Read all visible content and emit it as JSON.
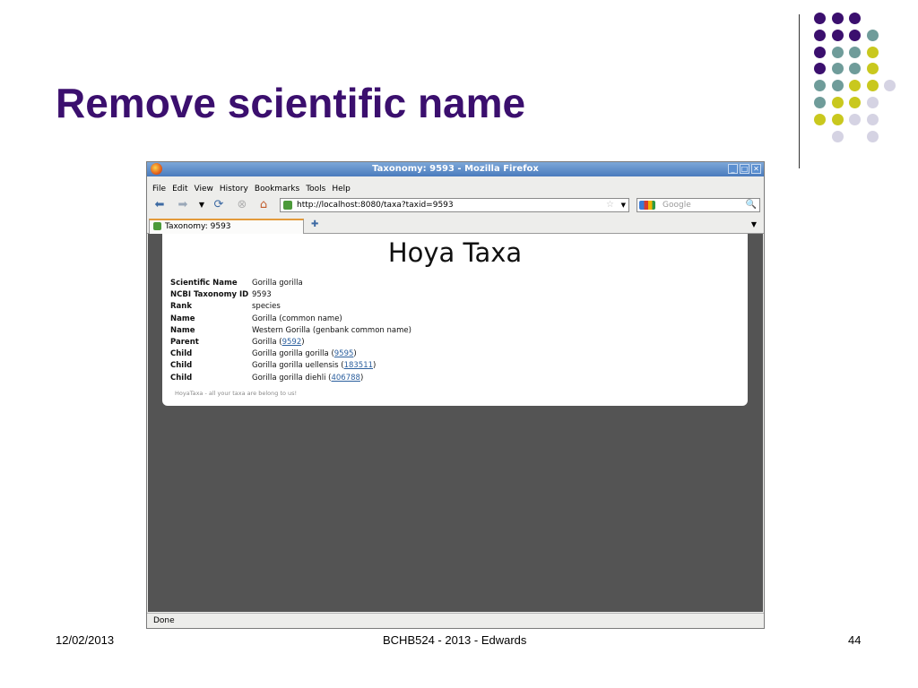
{
  "slide": {
    "title": "Remove scientific name",
    "footer_date": "12/02/2013",
    "footer_center": "BCHB524 - 2013 - Edwards",
    "footer_page": "44",
    "dot_colors": {
      "purple": "#3b0f6e",
      "teal": "#6f9c9a",
      "yellow": "#c9c81e",
      "lavender": "#d5d3e3"
    }
  },
  "browser": {
    "window_title": "Taxonomy: 9593 - Mozilla Firefox",
    "menu": [
      "File",
      "Edit",
      "View",
      "History",
      "Bookmarks",
      "Tools",
      "Help"
    ],
    "url": "http://localhost:8080/taxa?taxid=9593",
    "search_placeholder": "Google",
    "tab_label": "Taxonomy: 9593",
    "status": "Done",
    "icons": {
      "back": "back-arrow-icon",
      "forward": "forward-arrow-icon",
      "dropdown": "chevron-down-icon",
      "reload": "reload-icon",
      "stop": "stop-icon",
      "home": "home-icon",
      "bookmark_star": "star-icon",
      "search": "search-icon",
      "new_tab": "plus-icon"
    }
  },
  "page": {
    "heading": "Hoya Taxa",
    "rows": [
      {
        "key": "Scientific Name",
        "text": "Gorilla gorilla",
        "link": "",
        "suffix": ""
      },
      {
        "key": "NCBI Taxonomy ID",
        "text": "9593",
        "link": "",
        "suffix": ""
      },
      {
        "key": "Rank",
        "text": "species",
        "link": "",
        "suffix": ""
      },
      {
        "key": "Name",
        "text": "Gorilla (common name)",
        "link": "",
        "suffix": ""
      },
      {
        "key": "Name",
        "text": "Western Gorilla (genbank common name)",
        "link": "",
        "suffix": ""
      },
      {
        "key": "Parent",
        "text": "Gorilla (",
        "link": "9592",
        "suffix": ")"
      },
      {
        "key": "Child",
        "text": "Gorilla gorilla gorilla (",
        "link": "9595",
        "suffix": ")"
      },
      {
        "key": "Child",
        "text": "Gorilla gorilla uellensis (",
        "link": "183511",
        "suffix": ")"
      },
      {
        "key": "Child",
        "text": "Gorilla gorilla diehli (",
        "link": "406788",
        "suffix": ")"
      }
    ],
    "footer": "HoyaTaxa - all your taxa are belong to us!"
  }
}
